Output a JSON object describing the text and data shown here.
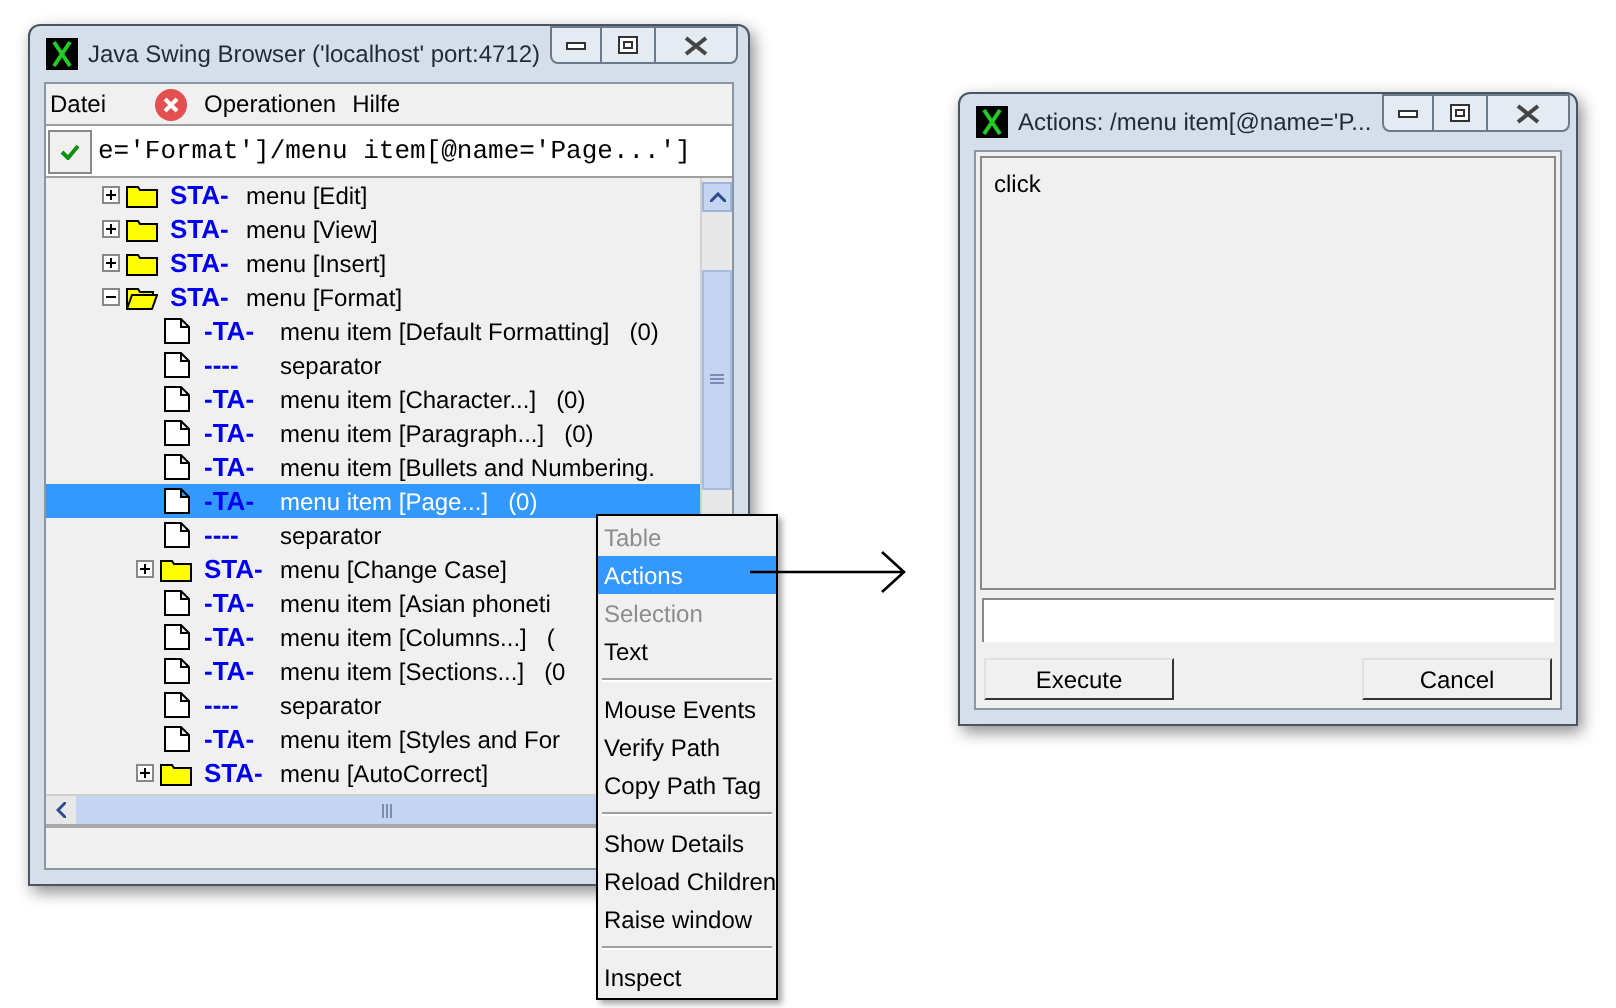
{
  "browser_window": {
    "title": "Java Swing Browser ('localhost' port:4712)",
    "menu": [
      {
        "kind": "text",
        "label": "Datei"
      },
      {
        "kind": "icon"
      },
      {
        "kind": "text",
        "label": "Operationen"
      },
      {
        "kind": "text",
        "label": "Hilfe"
      }
    ],
    "path_field": {
      "value": "e='Format']/menu item[@name='Page...']",
      "checked": true
    },
    "tree": [
      {
        "kind": "folder",
        "tag": "STA-",
        "label": "menu [Edit]",
        "expanded": false,
        "selected": false
      },
      {
        "kind": "folder",
        "tag": "STA-",
        "label": "menu [View]",
        "expanded": false,
        "selected": false
      },
      {
        "kind": "folder",
        "tag": "STA-",
        "label": "menu [Insert]",
        "expanded": false,
        "selected": false
      },
      {
        "kind": "folder",
        "tag": "STA-",
        "label": "menu [Format]",
        "expanded": true,
        "selected": false,
        "children": [
          {
            "kind": "item",
            "tag": "-TA-",
            "label": "menu item [Default Formatting]",
            "count": "(0)",
            "selected": false
          },
          {
            "kind": "item",
            "tag": "----",
            "label": "separator",
            "selected": false
          },
          {
            "kind": "item",
            "tag": "-TA-",
            "label": "menu item [Character...]",
            "count": "(0)",
            "selected": false
          },
          {
            "kind": "item",
            "tag": "-TA-",
            "label": "menu item [Paragraph...]",
            "count": "(0)",
            "selected": false
          },
          {
            "kind": "item",
            "tag": "-TA-",
            "label": "menu item [Bullets and Numbering.",
            "selected": false
          },
          {
            "kind": "item",
            "tag": "-TA-",
            "label": "menu item [Page...]",
            "count": "(0)",
            "selected": true
          },
          {
            "kind": "item",
            "tag": "----",
            "label": "separator",
            "selected": false
          },
          {
            "kind": "folder",
            "tag": "STA-",
            "label": "menu [Change Case]",
            "expanded": false,
            "selected": false
          },
          {
            "kind": "item",
            "tag": "-TA-",
            "label": "menu item [Asian phoneti",
            "selected": false
          },
          {
            "kind": "item",
            "tag": "-TA-",
            "label": "menu item [Columns...]",
            "count": "(",
            "selected": false
          },
          {
            "kind": "item",
            "tag": "-TA-",
            "label": "menu item [Sections...]",
            "count": "(0",
            "selected": false
          },
          {
            "kind": "item",
            "tag": "----",
            "label": "separator",
            "selected": false
          },
          {
            "kind": "item",
            "tag": "-TA-",
            "label": "menu item [Styles and For",
            "selected": false
          },
          {
            "kind": "folder",
            "tag": "STA-",
            "label": "menu [AutoCorrect]",
            "expanded": false,
            "selected": false
          }
        ]
      }
    ]
  },
  "context_menu": {
    "items": [
      {
        "kind": "item",
        "label": "Table",
        "disabled": true,
        "selected": false
      },
      {
        "kind": "item",
        "label": "Actions",
        "disabled": false,
        "selected": true
      },
      {
        "kind": "item",
        "label": "Selection",
        "disabled": true,
        "selected": false
      },
      {
        "kind": "item",
        "label": "Text",
        "disabled": false,
        "selected": false
      },
      {
        "kind": "separator"
      },
      {
        "kind": "item",
        "label": "Mouse Events",
        "disabled": false,
        "selected": false
      },
      {
        "kind": "item",
        "label": "Verify Path",
        "disabled": false,
        "selected": false
      },
      {
        "kind": "item",
        "label": "Copy Path Tag",
        "disabled": false,
        "selected": false
      },
      {
        "kind": "separator"
      },
      {
        "kind": "item",
        "label": "Show Details",
        "disabled": false,
        "selected": false
      },
      {
        "kind": "item",
        "label": "Reload Children",
        "disabled": false,
        "selected": false
      },
      {
        "kind": "item",
        "label": "Raise window",
        "disabled": false,
        "selected": false
      },
      {
        "kind": "separator"
      },
      {
        "kind": "item",
        "label": "Inspect",
        "disabled": false,
        "selected": false
      }
    ]
  },
  "actions_window": {
    "title": "Actions: /menu item[@name='P...",
    "actions": [
      {
        "label": "click",
        "selected": false
      }
    ],
    "buttons": [
      "Execute",
      "Cancel"
    ]
  }
}
